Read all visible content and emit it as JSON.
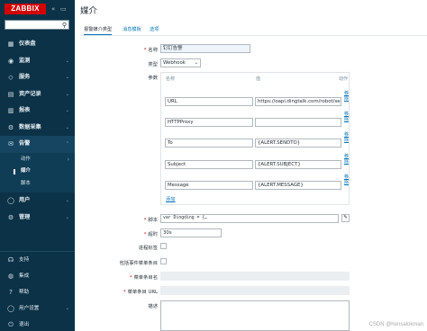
{
  "sidebar": {
    "logo": "ZABBIX",
    "collapse_icon": "«",
    "window_icon": "▭",
    "items": [
      {
        "icon": "▦",
        "label": "仪表盘"
      },
      {
        "icon": "◉",
        "label": "监测",
        "chevron": "⌄"
      },
      {
        "icon": "◇",
        "label": "服务",
        "chevron": "⌄"
      },
      {
        "icon": "▤",
        "label": "资产记录",
        "chevron": "⌄"
      },
      {
        "icon": "▥",
        "label": "报表",
        "chevron": "⌄"
      },
      {
        "icon": "⚙",
        "label": "数据采集",
        "chevron": "⌄"
      },
      {
        "icon": "✉",
        "label": "告警",
        "chevron": "⌃"
      }
    ],
    "alerts_sub": [
      "动作",
      "媒介",
      "脚本"
    ],
    "alerts_sub_chevron": "›",
    "items_after": [
      {
        "icon": "◯",
        "label": "用户",
        "chevron": "⌄"
      },
      {
        "icon": "⚙",
        "label": "管理",
        "chevron": "⌄"
      }
    ],
    "bottom": [
      {
        "icon": "☊",
        "label": "支持"
      },
      {
        "icon": "◍",
        "label": "集成"
      },
      {
        "icon": "?",
        "label": "帮助"
      },
      {
        "icon": "◯",
        "label": "用户设置",
        "chevron": "⌄"
      },
      {
        "icon": "⏻",
        "label": "退出"
      }
    ]
  },
  "page": {
    "title": "媒介",
    "tabs": [
      "报警媒介类型",
      "消息模板",
      "选项"
    ]
  },
  "form": {
    "name_label": "名称",
    "name_value": "钉钉告警",
    "type_label": "类型",
    "type_value": "Webhook",
    "params_label": "参数",
    "col_name": "名称",
    "col_value": "值",
    "col_action": "动作",
    "params": [
      {
        "name": "URL",
        "value": "https://oapi.dingtalk.com/robot/send?i"
      },
      {
        "name": "HTTPProxy",
        "value": ""
      },
      {
        "name": "To",
        "value": "{ALERT.SENDTO}"
      },
      {
        "name": "Subject",
        "value": "{ALERT.SUBJECT}"
      },
      {
        "name": "Message",
        "value": "{ALERT.MESSAGE}"
      }
    ],
    "remove_label": "移除",
    "add_label": "添加",
    "script_label": "脚本",
    "script_value": "var Dingding = {…",
    "edit_icon": "✎",
    "timeout_label": "超时",
    "timeout_value": "30s",
    "process_tags_label": "进程标签",
    "include_event_menu_label": "包括事件菜单条目",
    "menu_entry_name_label": "菜单条目名",
    "menu_entry_url_label": "菜单条目 URL",
    "description_label": "描述",
    "select_arrow": "⌄"
  },
  "watermark": "CSDN @hensalokman"
}
